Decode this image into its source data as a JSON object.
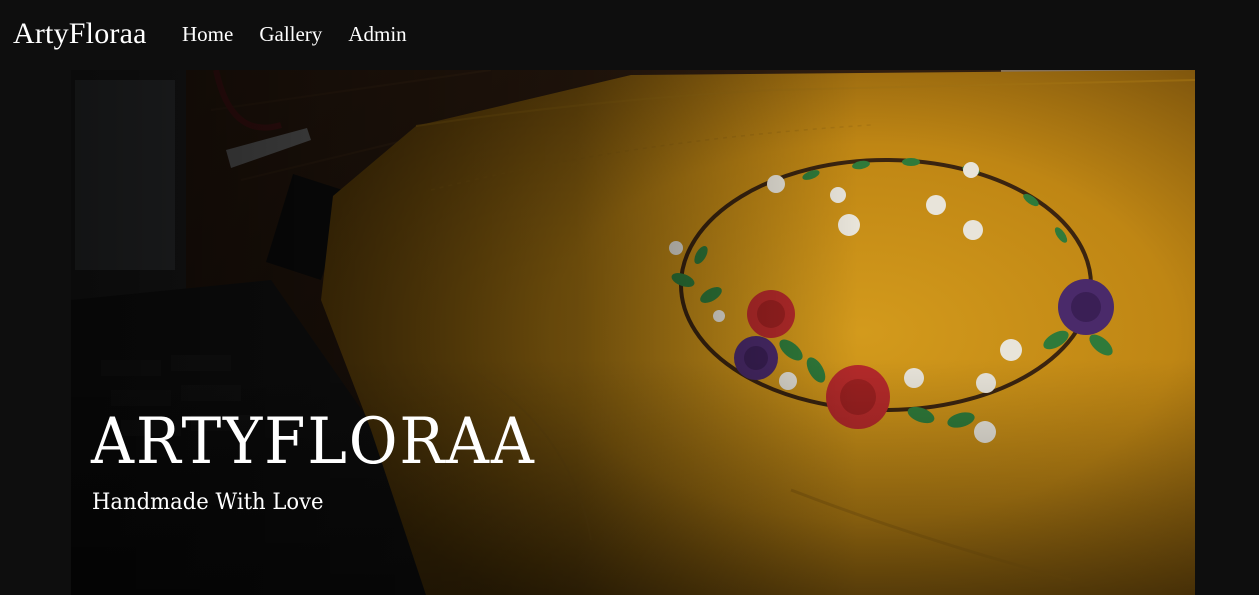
{
  "navbar": {
    "brand": "ArtyFloraa",
    "links": [
      {
        "label": "Home"
      },
      {
        "label": "Gallery"
      },
      {
        "label": "Admin"
      }
    ]
  },
  "hero": {
    "title": "ARTYFLORAA",
    "subtitle": "Handmade With Love",
    "image": "embroidered-yellow-tote-bag-photo"
  },
  "colors": {
    "background": "#0e0e0e",
    "text": "#ffffff",
    "fabric": "#c8921a",
    "embroidery_red": "#b42a2a",
    "embroidery_purple": "#4a2a6a",
    "embroidery_green": "#2f7a3a"
  }
}
